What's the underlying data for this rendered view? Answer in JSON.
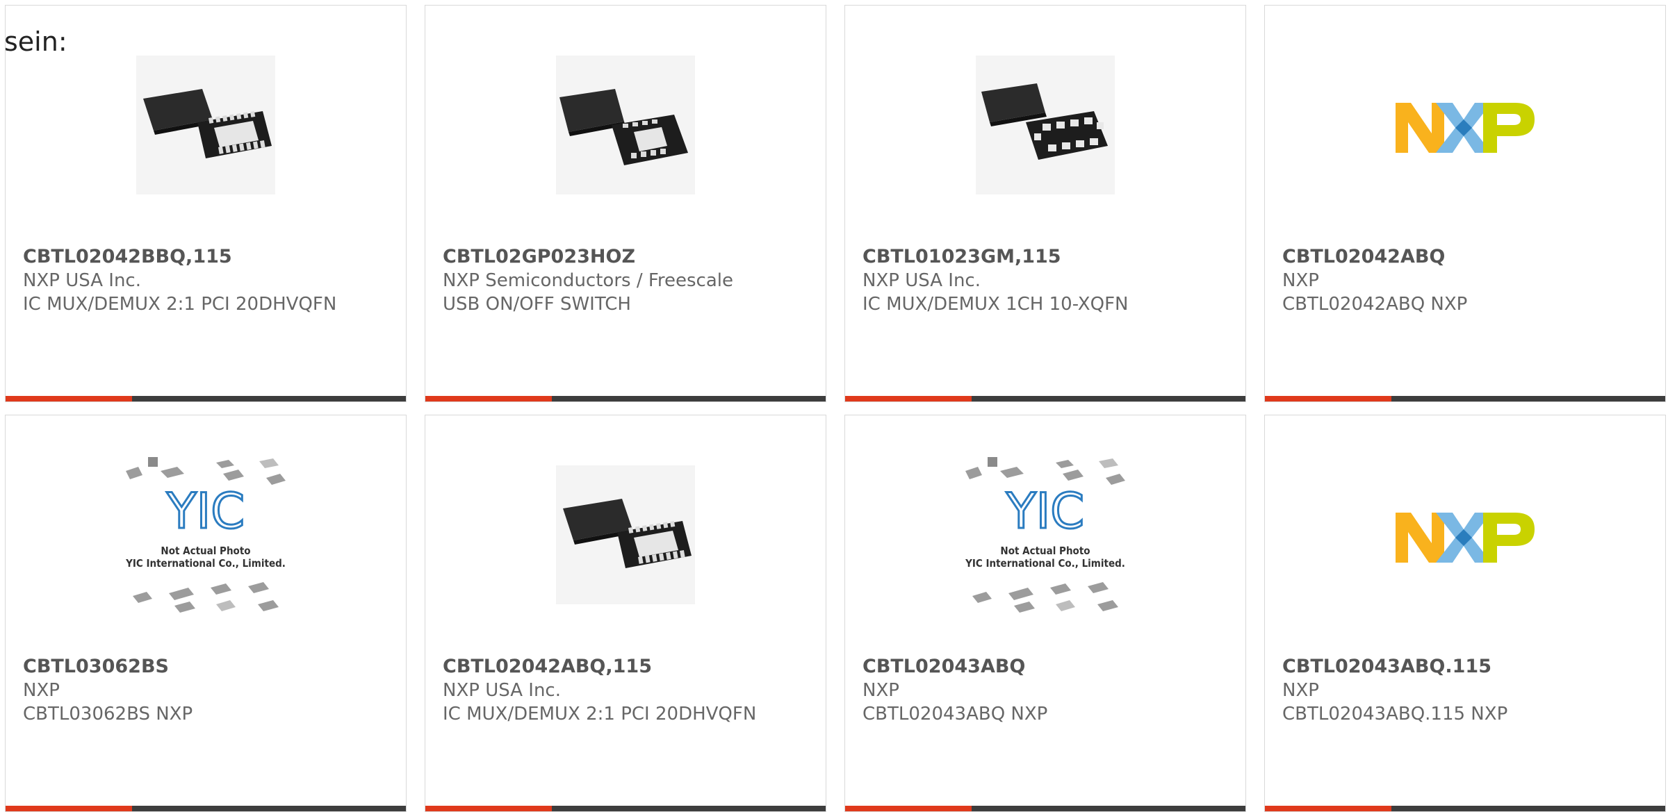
{
  "lead_text": "sein:",
  "colors": {
    "accent": "#e0391b",
    "bar": "#3d3d3d",
    "border": "#d9d9d9"
  },
  "products": [
    {
      "part": "CBTL02042BBQ,115",
      "mfr": "NXP USA Inc.",
      "desc": "IC MUX/DEMUX 2:1 PCI 20DHVQFN",
      "image": "chip-dhvqfn-photo"
    },
    {
      "part": "CBTL02GP023HOZ",
      "mfr": "NXP Semiconductors / Freescale",
      "desc": "USB ON/OFF SWITCH",
      "image": "chip-xqfn-photo"
    },
    {
      "part": "CBTL01023GM,115",
      "mfr": "NXP USA Inc.",
      "desc": "IC MUX/DEMUX 1CH 10-XQFN",
      "image": "chip-10pad-photo"
    },
    {
      "part": "CBTL02042ABQ",
      "mfr": "NXP",
      "desc": "CBTL02042ABQ NXP",
      "image": "nxp-logo"
    },
    {
      "part": "CBTL03062BS",
      "mfr": "NXP",
      "desc": "CBTL03062BS NXP",
      "image": "yic-placeholder"
    },
    {
      "part": "CBTL02042ABQ,115",
      "mfr": "NXP USA Inc.",
      "desc": "IC MUX/DEMUX 2:1 PCI 20DHVQFN",
      "image": "chip-dhvqfn-photo"
    },
    {
      "part": "CBTL02043ABQ",
      "mfr": "NXP",
      "desc": "CBTL02043ABQ NXP",
      "image": "yic-placeholder"
    },
    {
      "part": "CBTL02043ABQ.115",
      "mfr": "NXP",
      "desc": "CBTL02043ABQ.115 NXP",
      "image": "nxp-logo"
    }
  ],
  "yic_placeholder": {
    "logo_text": "YIC",
    "line1": "Not Actual Photo",
    "line2": "YIC International Co., Limited."
  }
}
